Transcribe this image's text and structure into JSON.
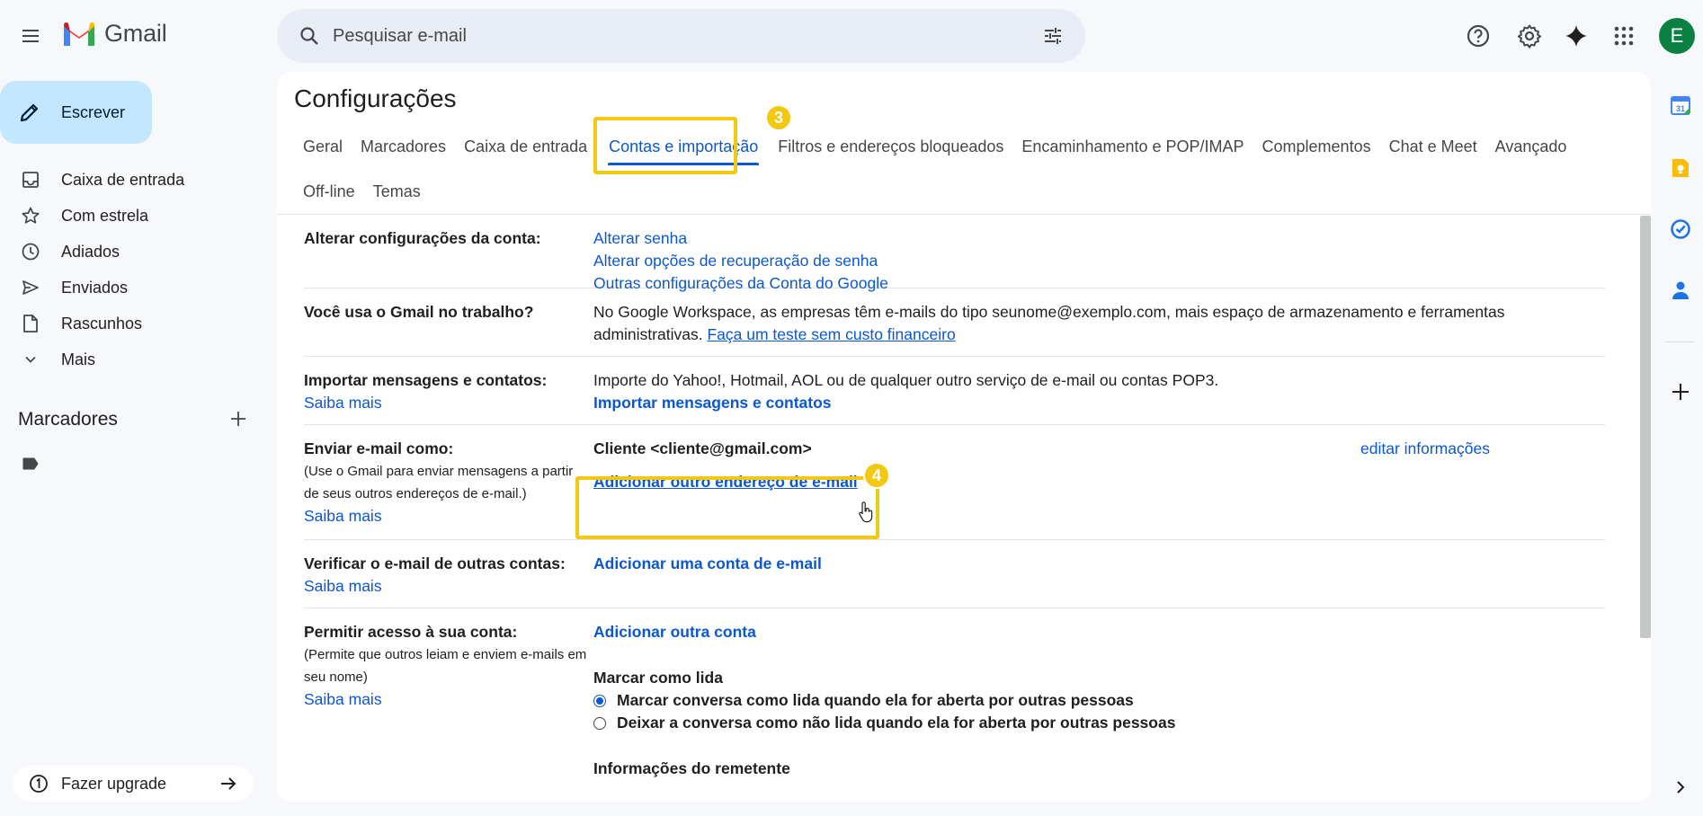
{
  "app": {
    "name": "Gmail"
  },
  "search": {
    "placeholder": "Pesquisar e-mail"
  },
  "account": {
    "initial": "E",
    "avatar_color": "#0b8043"
  },
  "compose": {
    "label": "Escrever"
  },
  "nav": {
    "items": [
      {
        "label": "Caixa de entrada",
        "icon": "inbox-icon"
      },
      {
        "label": "Com estrela",
        "icon": "star-icon"
      },
      {
        "label": "Adiados",
        "icon": "clock-icon"
      },
      {
        "label": "Enviados",
        "icon": "send-icon"
      },
      {
        "label": "Rascunhos",
        "icon": "draft-icon"
      },
      {
        "label": "Mais",
        "icon": "chevron-down-icon"
      }
    ],
    "labels_heading": "Marcadores",
    "upgrade_label": "Fazer upgrade"
  },
  "settings": {
    "title": "Configurações",
    "tabs": [
      {
        "label": "Geral"
      },
      {
        "label": "Marcadores"
      },
      {
        "label": "Caixa de entrada"
      },
      {
        "label": "Contas e importação",
        "active": true
      },
      {
        "label": "Filtros e endereços bloqueados"
      },
      {
        "label": "Encaminhamento e POP/IMAP"
      },
      {
        "label": "Complementos"
      },
      {
        "label": "Chat e Meet"
      },
      {
        "label": "Avançado"
      },
      {
        "label": "Off-line"
      },
      {
        "label": "Temas"
      }
    ],
    "callouts": {
      "tab_step": "3",
      "add_address_step": "4"
    },
    "highlight_color": "#f2c811",
    "sections": {
      "account": {
        "label": "Alterar configurações da conta:",
        "links": [
          "Alterar senha",
          "Alterar opções de recuperação de senha",
          "Outras configurações da Conta do Google"
        ]
      },
      "work": {
        "label": "Você usa o Gmail no trabalho?",
        "text_line1": "No Google Workspace, as empresas têm e-mails do tipo seunome@exemplo.com, mais espaço de armazenamento e ferramentas",
        "text_line2": "administrativas.",
        "link": "Faça um teste sem custo financeiro"
      },
      "import": {
        "label": "Importar mensagens e contatos:",
        "learn_more": "Saiba mais",
        "text": "Importe do Yahoo!, Hotmail, AOL ou de qualquer outro serviço de e-mail ou contas POP3.",
        "action": "Importar mensagens e contatos"
      },
      "send_as": {
        "label": "Enviar e-mail como:",
        "desc_line1": "(Use o Gmail para enviar mensagens a partir",
        "desc_line2": "de seus outros endereços de e-mail.)",
        "learn_more": "Saiba mais",
        "address": "Cliente <cliente@gmail.com>",
        "edit": "editar informações",
        "add": "Adicionar outro endereço de e-mail"
      },
      "check_mail": {
        "label": "Verificar o e-mail de outras contas:",
        "learn_more": "Saiba mais",
        "action": "Adicionar uma conta de e-mail"
      },
      "grant_access": {
        "label": "Permitir acesso à sua conta:",
        "desc_line1": "(Permite que outros leiam e enviem e-mails em",
        "desc_line2": "seu nome)",
        "learn_more": "Saiba mais",
        "action": "Adicionar outra conta",
        "mark_read_heading": "Marcar como lida",
        "option_1": "Marcar conversa como lida quando ela for aberta por outras pessoas",
        "option_2": "Deixar a conversa como não lida quando ela for aberta por outras pessoas",
        "sender_info_heading": "Informações do remetente"
      }
    }
  }
}
